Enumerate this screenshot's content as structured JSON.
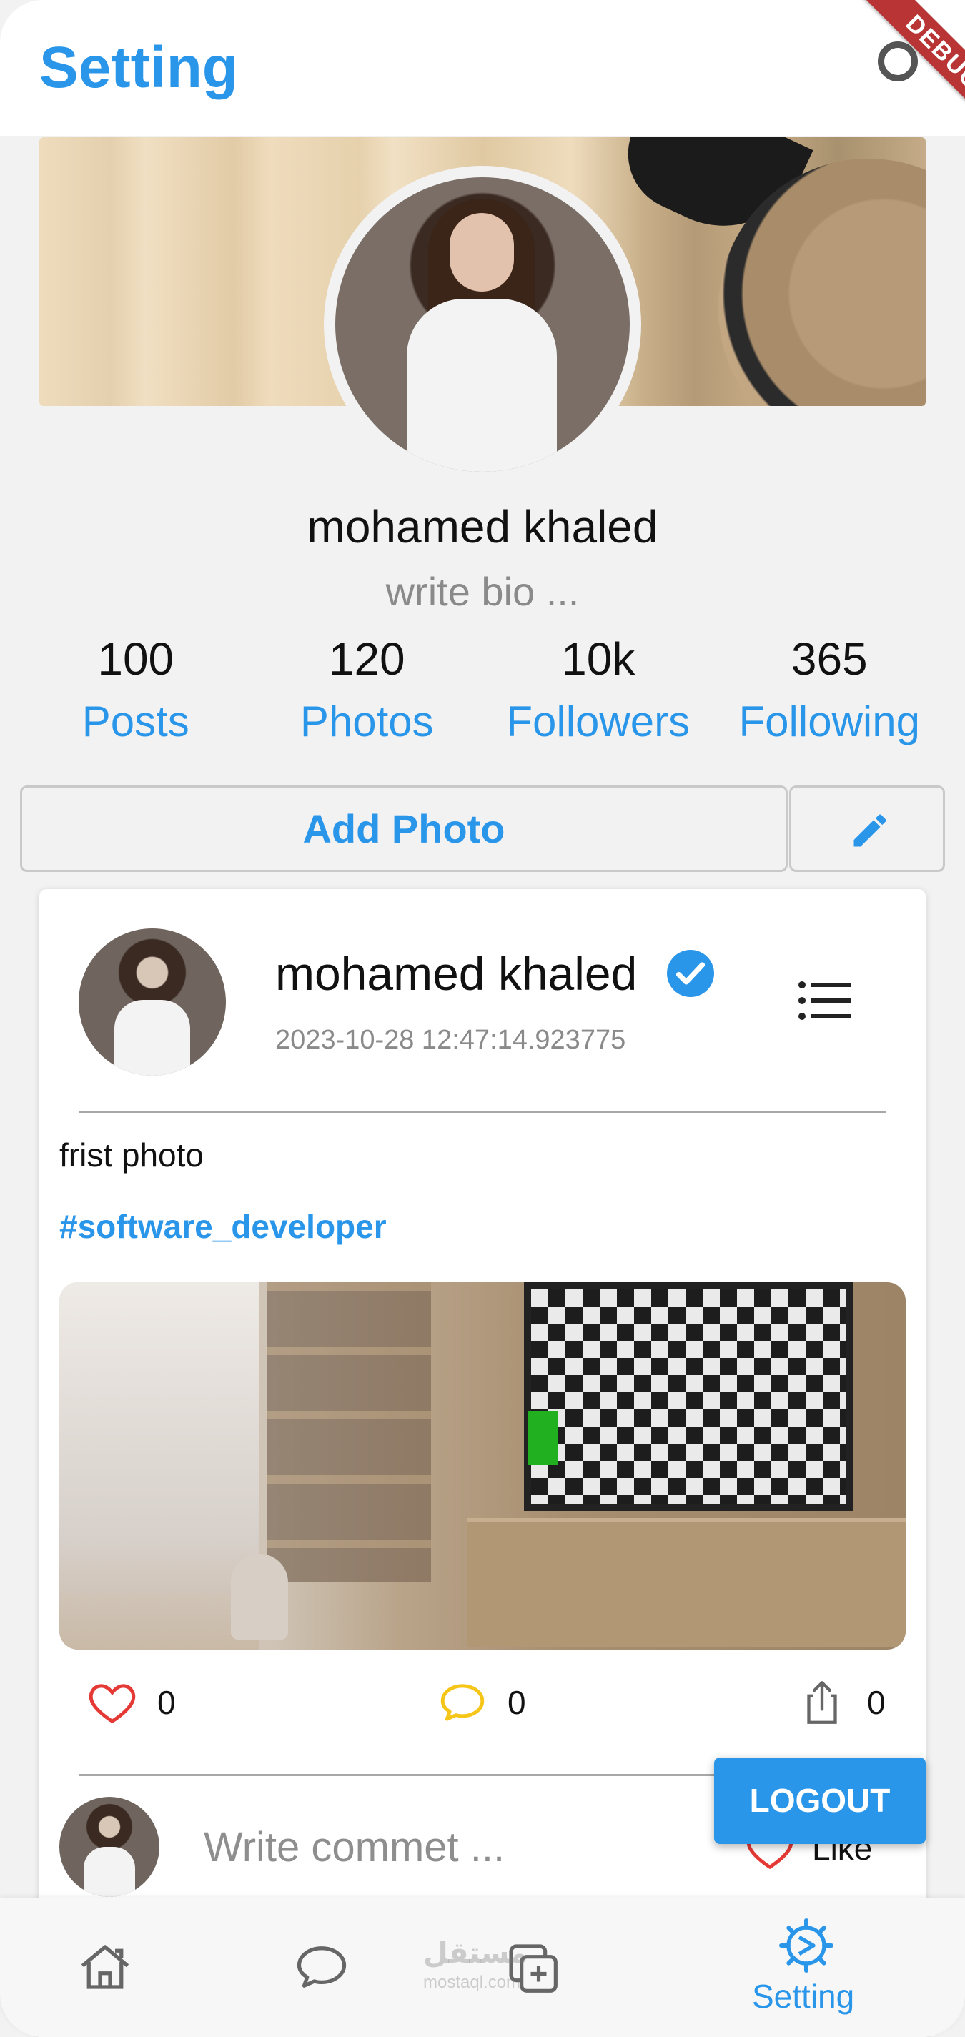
{
  "app_bar": {
    "title": "Setting",
    "debug_label": "DEBUG"
  },
  "profile": {
    "name": "mohamed khaled",
    "bio": "write bio ...",
    "stats": [
      {
        "value": "100",
        "label": "Posts"
      },
      {
        "value": "120",
        "label": "Photos"
      },
      {
        "value": "10k",
        "label": "Followers"
      },
      {
        "value": "365",
        "label": "Following"
      }
    ],
    "add_photo_label": "Add Photo"
  },
  "post": {
    "author": "mohamed khaled",
    "timestamp": "2023-10-28 12:47:14.923775",
    "caption": "frist photo",
    "hashtag": "#software_developer",
    "likes": "0",
    "comments": "0",
    "shares": "0",
    "comment_placeholder": "Write commet ...",
    "like_label": "Like"
  },
  "logout_label": "LOGOUT",
  "bottom_nav": {
    "active_label": "Setting",
    "items": [
      "home-icon",
      "chat-icon",
      "add-post-icon",
      "settings-icon"
    ]
  },
  "watermark": {
    "text": "مستقل",
    "sub": "mostaql.com"
  },
  "colors": {
    "accent": "#2a96ea",
    "like": "#e53935",
    "comment": "#f5c518",
    "background": "#f2f2f2"
  }
}
